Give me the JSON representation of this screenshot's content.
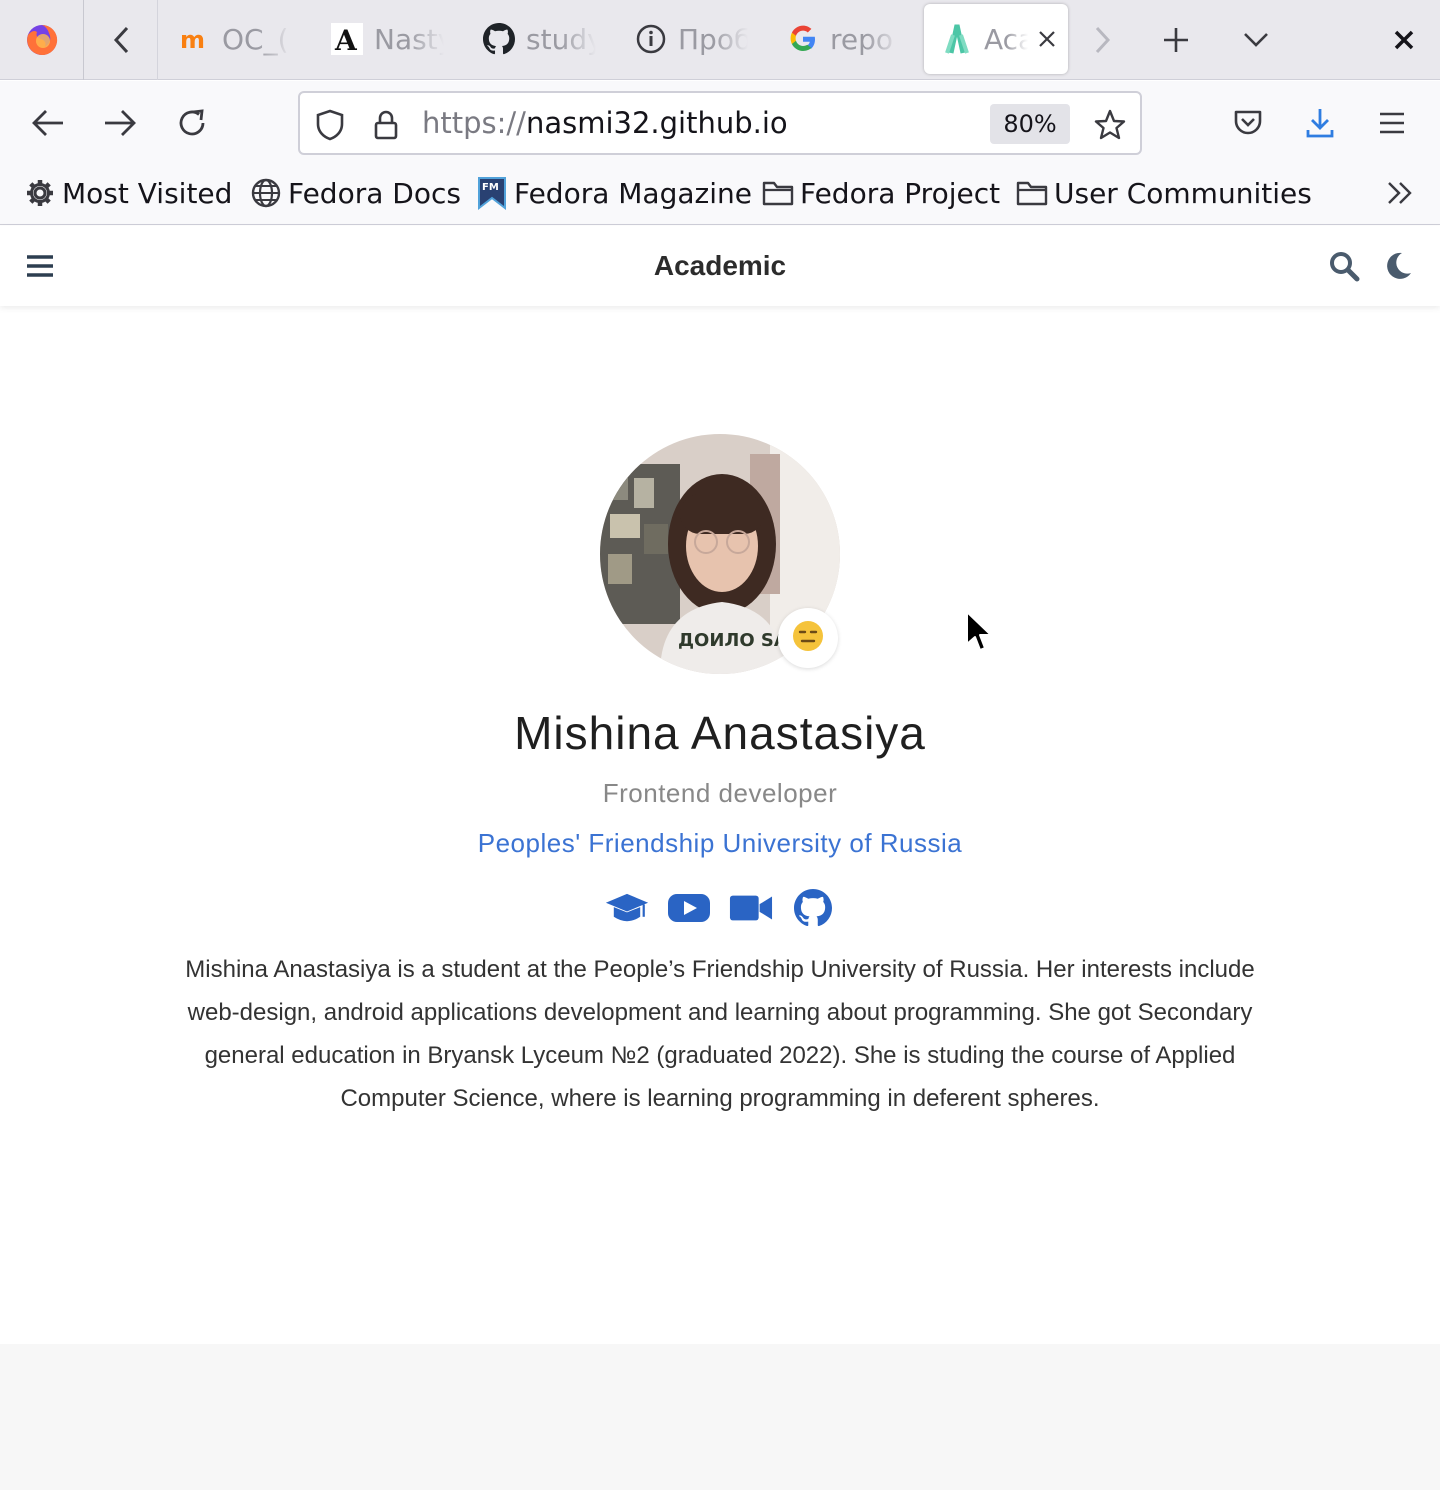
{
  "browser": {
    "tabs": [
      {
        "title": "OC_(",
        "icon": "moodle-icon"
      },
      {
        "title": "Nasty",
        "icon": "serif-a-icon"
      },
      {
        "title": "study",
        "icon": "github-icon"
      },
      {
        "title": "Проб",
        "icon": "info-icon"
      },
      {
        "title": "repo",
        "icon": "google-icon"
      },
      {
        "title": "Aca",
        "icon": "academic-icon",
        "active": true
      }
    ],
    "url": {
      "scheme": "https://",
      "host": "nasmi32.github.io"
    },
    "zoom": "80%",
    "bookmarks": [
      {
        "label": "Most Visited",
        "icon": "gear-icon"
      },
      {
        "label": "Fedora Docs",
        "icon": "globe-icon"
      },
      {
        "label": "Fedora Magazine",
        "icon": "fm-icon"
      },
      {
        "label": "Fedora Project",
        "icon": "folder-icon"
      },
      {
        "label": "User Communities",
        "icon": "folder-icon"
      }
    ]
  },
  "site": {
    "brand": "Academic"
  },
  "profile": {
    "name": "Mishina Anastasiya",
    "role": "Frontend developer",
    "organization": "Peoples' Friendship University of Russia",
    "status_emoji": "😑",
    "social_icons": [
      "graduation-cap-icon",
      "youtube-icon",
      "video-camera-icon",
      "github-icon"
    ],
    "bio": "Mishina Anastasiya is a student at the People’s Friendship University of Russia. Her interests include web-design, android applications development and learning about programming. She got Secondary general education in Bryansk Lyceum №2 (graduated 2022). She is studing the course of Applied Computer Science, where is learning programming in deferent spheres."
  },
  "colors": {
    "accent": "#3b73d3",
    "social_icon": "#2a64c4",
    "download_blue": "#2f7de1"
  }
}
